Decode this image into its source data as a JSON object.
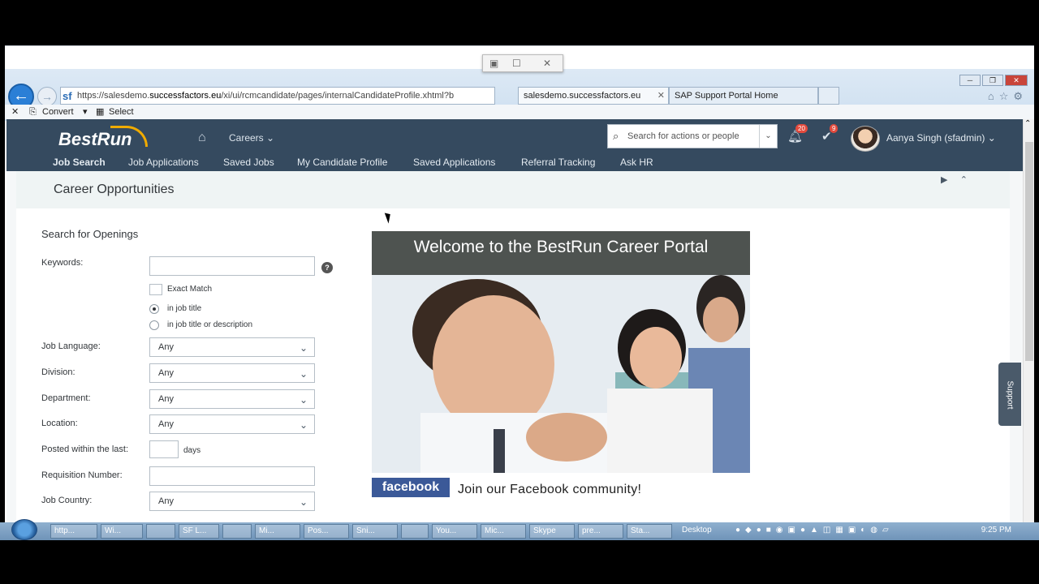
{
  "browser": {
    "url_prefix": "https://salesdemo.",
    "url_domain": "successfactors.eu",
    "url_path": "/xi/ui/rcmcandidate/pages/internalCandidateProfile.xhtml?b",
    "tabs": [
      {
        "label": "salesdemo.successfactors.eu"
      },
      {
        "label": "SAP Support Portal Home"
      }
    ],
    "command_bar": {
      "convert_label": "Convert",
      "select_label": "Select"
    }
  },
  "header": {
    "logo_text": "BestRun",
    "careers_menu": "Careers",
    "search_placeholder": "Search for actions or people",
    "notifications_count": "20",
    "tasks_count": "9",
    "user_name": "Aanya Singh (sfadmin)"
  },
  "nav": {
    "items": [
      {
        "label": "Job Search"
      },
      {
        "label": "Job Applications"
      },
      {
        "label": "Saved Jobs"
      },
      {
        "label": "My Candidate Profile"
      },
      {
        "label": "Saved Applications"
      },
      {
        "label": "Referral Tracking"
      },
      {
        "label": "Ask HR"
      }
    ]
  },
  "page": {
    "title": "Career Opportunities",
    "section_title": "Search for Openings",
    "keywords_label": "Keywords:",
    "exact_match_label": "Exact Match",
    "radio_job_title": "in job title",
    "radio_job_title_desc": "in job title or description",
    "job_language_label": "Job Language:",
    "job_language_value": "Any",
    "division_label": "Division:",
    "division_value": "Any",
    "department_label": "Department:",
    "department_value": "Any",
    "location_label": "Location:",
    "location_value": "Any",
    "posted_label": "Posted within the last:",
    "days_label": "days",
    "requisition_label": "Requisition Number:",
    "job_country_label": "Job Country:",
    "job_country_value": "Any"
  },
  "banner": {
    "title": "Welcome to the BestRun Career Portal",
    "facebook_logo": "facebook",
    "facebook_text": "Join our Facebook community!"
  },
  "support_tab": "Support",
  "taskbar": {
    "items": [
      "http...",
      "Wi...",
      "",
      "SF L...",
      "",
      "Mi...",
      "Pos...",
      "Sni...",
      "",
      "You...",
      "Mic...",
      "Skype",
      "pre...",
      "Sta..."
    ],
    "desktop_label": "Desktop",
    "clock": "9:25 PM"
  }
}
